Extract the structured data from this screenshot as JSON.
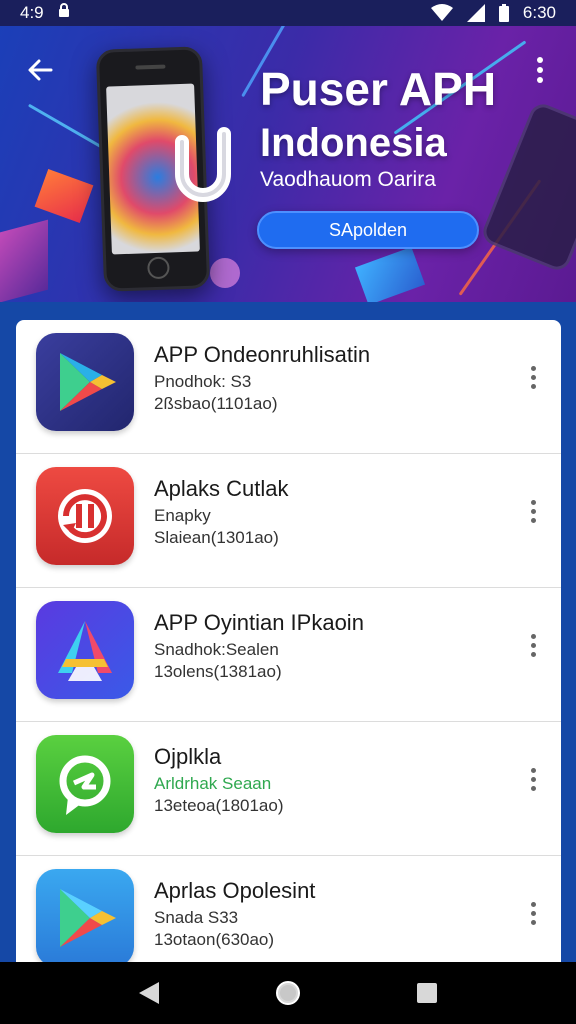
{
  "status_bar": {
    "time": "4:9",
    "clock": "6:30",
    "icons": [
      "lock-icon",
      "wifi-icon",
      "signal-icon",
      "battery-icon"
    ]
  },
  "hero": {
    "title_line1": "Puser APH",
    "title_line2": "Indonesia",
    "subtitle": "Vaodhauom Oarira",
    "button_label": "SApolden",
    "colors": {
      "gradient_start": "#1b3fb8",
      "gradient_end": "#6a22a8",
      "button": "#1f6cf0"
    }
  },
  "apps": [
    {
      "name": "APP Ondeonruhlisatin",
      "subtitle": "Pnodhok: S3",
      "meta": "2ßsbao(1101ao)",
      "icon": "play-store-icon",
      "subtitle_color": "#333333"
    },
    {
      "name": "Aplaks Cutlak",
      "subtitle": "Enapky",
      "meta": "Slaiean(1301ao)",
      "icon": "update-icon",
      "subtitle_color": "#333333"
    },
    {
      "name": "APP Oyintian IPkaoin",
      "subtitle": "Snadhok:Sealen",
      "meta": "13olens(1381ao)",
      "icon": "gradient-a-icon",
      "subtitle_color": "#333333"
    },
    {
      "name": "Ojplkla",
      "subtitle": "Arldrhak Seaan",
      "meta": "13eteoa(1801ao)",
      "icon": "green-refresh-icon",
      "subtitle_color": "#2fa84f"
    },
    {
      "name": "Aprlas Opolesint",
      "subtitle": "Snada S33",
      "meta": "13otaon(630ao)",
      "icon": "blue-play-icon",
      "subtitle_color": "#333333"
    }
  ],
  "nav": {
    "icons": [
      "back-triangle-icon",
      "home-circle-icon",
      "recents-square-icon"
    ]
  }
}
